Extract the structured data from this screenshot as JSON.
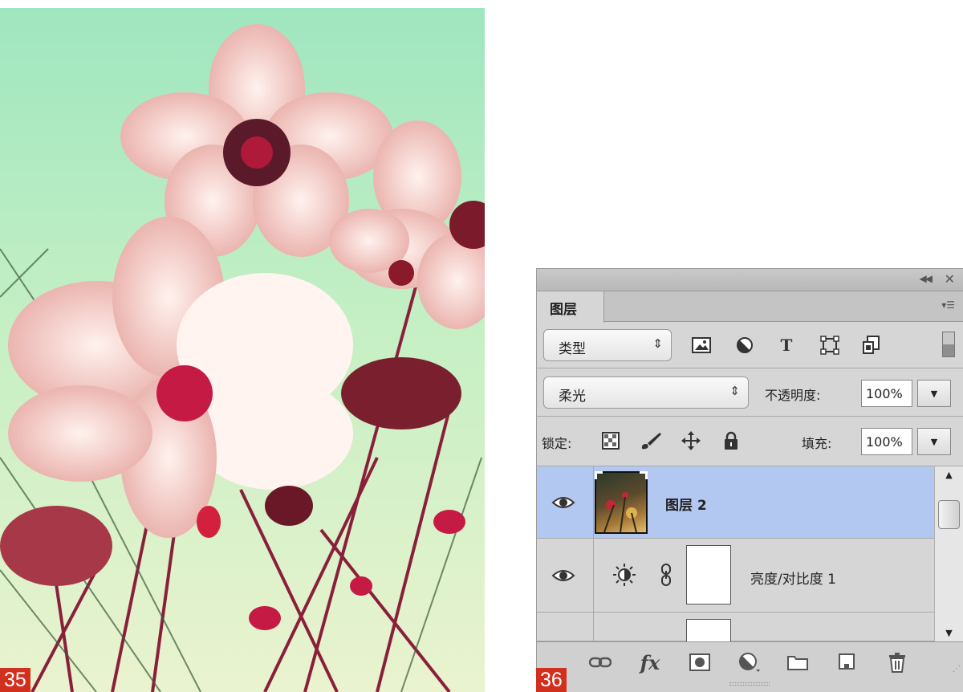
{
  "badges": {
    "left": "35",
    "right": "36"
  },
  "panel": {
    "tab_title": "图层",
    "collapse_icon": "collapse-panel-icon",
    "close_icon": "close-icon",
    "menu_icon": "panel-menu-icon",
    "filter": {
      "selected": "类型",
      "icons": [
        "pixel-filter-icon",
        "adjustment-filter-icon",
        "type-filter-icon",
        "shape-filter-icon",
        "smart-object-filter-icon"
      ],
      "type_glyph": "T"
    },
    "blend": {
      "mode": "柔光",
      "opacity_label": "不透明度:",
      "opacity_value": "100%"
    },
    "lock": {
      "label": "锁定:",
      "fill_label": "填充:",
      "fill_value": "100%",
      "icons": [
        "lock-transparent-icon",
        "lock-image-icon",
        "lock-position-icon",
        "lock-all-icon"
      ]
    },
    "layers": [
      {
        "name": "图层 2",
        "visible": true,
        "selected": true
      },
      {
        "name": "亮度/对比度 1",
        "visible": true,
        "selected": false
      }
    ],
    "toolbar_icons": [
      "link-layers-icon",
      "fx-icon",
      "add-mask-icon",
      "adjustment-layer-icon",
      "new-group-icon",
      "new-layer-icon",
      "delete-icon"
    ],
    "fx_label": "fx",
    "selection_color": "#b3c8f0"
  }
}
